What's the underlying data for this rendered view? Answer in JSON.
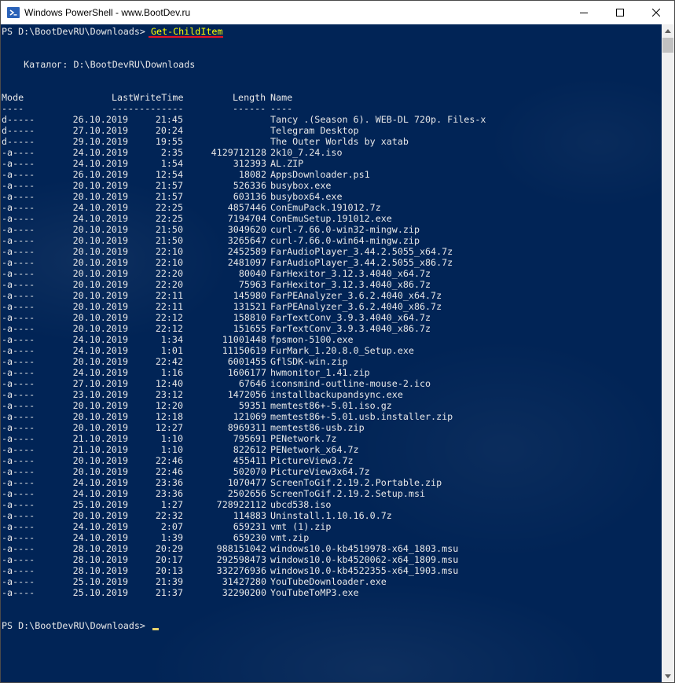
{
  "window": {
    "title": "Windows PowerShell - www.BootDev.ru",
    "controls": {
      "minimize": "minimize-icon",
      "maximize": "maximize-icon",
      "close": "close-icon"
    }
  },
  "console": {
    "prompt": "PS D:\\BootDevRU\\Downloads> ",
    "command": "Get-ChildItem",
    "directory_line": "    Каталог: D:\\BootDevRU\\Downloads",
    "headers": {
      "mode": "Mode",
      "date_time": "LastWriteTime",
      "length": "Length",
      "name": "Name"
    },
    "separators": {
      "mode": "----",
      "date_time": "-------------",
      "length": "------",
      "name": "----"
    },
    "rows": [
      {
        "mode": "d-----",
        "date": "26.10.2019",
        "time": "21:45",
        "length": "",
        "name": "Tancy .(Season 6). WEB-DL 720p. Files-x"
      },
      {
        "mode": "d-----",
        "date": "27.10.2019",
        "time": "20:24",
        "length": "",
        "name": "Telegram Desktop"
      },
      {
        "mode": "d-----",
        "date": "29.10.2019",
        "time": "19:55",
        "length": "",
        "name": "The Outer Worlds by xatab"
      },
      {
        "mode": "-a----",
        "date": "24.10.2019",
        "time": "2:35",
        "length": "4129712128",
        "name": "2k10_7.24.iso"
      },
      {
        "mode": "-a----",
        "date": "24.10.2019",
        "time": "1:54",
        "length": "312393",
        "name": "AL.ZIP"
      },
      {
        "mode": "-a----",
        "date": "26.10.2019",
        "time": "12:54",
        "length": "18082",
        "name": "AppsDownloader.ps1"
      },
      {
        "mode": "-a----",
        "date": "20.10.2019",
        "time": "21:57",
        "length": "526336",
        "name": "busybox.exe"
      },
      {
        "mode": "-a----",
        "date": "20.10.2019",
        "time": "21:57",
        "length": "603136",
        "name": "busybox64.exe"
      },
      {
        "mode": "-a----",
        "date": "24.10.2019",
        "time": "22:25",
        "length": "4857446",
        "name": "ConEmuPack.191012.7z"
      },
      {
        "mode": "-a----",
        "date": "24.10.2019",
        "time": "22:25",
        "length": "7194704",
        "name": "ConEmuSetup.191012.exe"
      },
      {
        "mode": "-a----",
        "date": "20.10.2019",
        "time": "21:50",
        "length": "3049620",
        "name": "curl-7.66.0-win32-mingw.zip"
      },
      {
        "mode": "-a----",
        "date": "20.10.2019",
        "time": "21:50",
        "length": "3265647",
        "name": "curl-7.66.0-win64-mingw.zip"
      },
      {
        "mode": "-a----",
        "date": "20.10.2019",
        "time": "22:10",
        "length": "2452589",
        "name": "FarAudioPlayer_3.44.2.5055_x64.7z"
      },
      {
        "mode": "-a----",
        "date": "20.10.2019",
        "time": "22:10",
        "length": "2481097",
        "name": "FarAudioPlayer_3.44.2.5055_x86.7z"
      },
      {
        "mode": "-a----",
        "date": "20.10.2019",
        "time": "22:20",
        "length": "80040",
        "name": "FarHexitor_3.12.3.4040_x64.7z"
      },
      {
        "mode": "-a----",
        "date": "20.10.2019",
        "time": "22:20",
        "length": "75963",
        "name": "FarHexitor_3.12.3.4040_x86.7z"
      },
      {
        "mode": "-a----",
        "date": "20.10.2019",
        "time": "22:11",
        "length": "145980",
        "name": "FarPEAnalyzer_3.6.2.4040_x64.7z"
      },
      {
        "mode": "-a----",
        "date": "20.10.2019",
        "time": "22:11",
        "length": "131521",
        "name": "FarPEAnalyzer_3.6.2.4040_x86.7z"
      },
      {
        "mode": "-a----",
        "date": "20.10.2019",
        "time": "22:12",
        "length": "158810",
        "name": "FarTextConv_3.9.3.4040_x64.7z"
      },
      {
        "mode": "-a----",
        "date": "20.10.2019",
        "time": "22:12",
        "length": "151655",
        "name": "FarTextConv_3.9.3.4040_x86.7z"
      },
      {
        "mode": "-a----",
        "date": "24.10.2019",
        "time": "1:34",
        "length": "11001448",
        "name": "fpsmon-5100.exe"
      },
      {
        "mode": "-a----",
        "date": "24.10.2019",
        "time": "1:01",
        "length": "11150619",
        "name": "FurMark_1.20.8.0_Setup.exe"
      },
      {
        "mode": "-a----",
        "date": "20.10.2019",
        "time": "22:42",
        "length": "6001455",
        "name": "GflSDK-win.zip"
      },
      {
        "mode": "-a----",
        "date": "24.10.2019",
        "time": "1:16",
        "length": "1606177",
        "name": "hwmonitor_1.41.zip"
      },
      {
        "mode": "-a----",
        "date": "27.10.2019",
        "time": "12:40",
        "length": "67646",
        "name": "iconsmind-outline-mouse-2.ico"
      },
      {
        "mode": "-a----",
        "date": "23.10.2019",
        "time": "23:12",
        "length": "1472056",
        "name": "installbackupandsync.exe"
      },
      {
        "mode": "-a----",
        "date": "20.10.2019",
        "time": "12:20",
        "length": "59351",
        "name": "memtest86+-5.01.iso.gz"
      },
      {
        "mode": "-a----",
        "date": "20.10.2019",
        "time": "12:18",
        "length": "121069",
        "name": "memtest86+-5.01.usb.installer.zip"
      },
      {
        "mode": "-a----",
        "date": "20.10.2019",
        "time": "12:27",
        "length": "8969311",
        "name": "memtest86-usb.zip"
      },
      {
        "mode": "-a----",
        "date": "21.10.2019",
        "time": "1:10",
        "length": "795691",
        "name": "PENetwork.7z"
      },
      {
        "mode": "-a----",
        "date": "21.10.2019",
        "time": "1:10",
        "length": "822612",
        "name": "PENetwork_x64.7z"
      },
      {
        "mode": "-a----",
        "date": "20.10.2019",
        "time": "22:46",
        "length": "455411",
        "name": "PictureView3.7z"
      },
      {
        "mode": "-a----",
        "date": "20.10.2019",
        "time": "22:46",
        "length": "502070",
        "name": "PictureView3x64.7z"
      },
      {
        "mode": "-a----",
        "date": "24.10.2019",
        "time": "23:36",
        "length": "1070477",
        "name": "ScreenToGif.2.19.2.Portable.zip"
      },
      {
        "mode": "-a----",
        "date": "24.10.2019",
        "time": "23:36",
        "length": "2502656",
        "name": "ScreenToGif.2.19.2.Setup.msi"
      },
      {
        "mode": "-a----",
        "date": "25.10.2019",
        "time": "1:27",
        "length": "728922112",
        "name": "ubcd538.iso"
      },
      {
        "mode": "-a----",
        "date": "20.10.2019",
        "time": "22:32",
        "length": "114883",
        "name": "Uninstall.1.10.16.0.7z"
      },
      {
        "mode": "-a----",
        "date": "24.10.2019",
        "time": "2:07",
        "length": "659231",
        "name": "vmt (1).zip"
      },
      {
        "mode": "-a----",
        "date": "24.10.2019",
        "time": "1:39",
        "length": "659230",
        "name": "vmt.zip"
      },
      {
        "mode": "-a----",
        "date": "28.10.2019",
        "time": "20:29",
        "length": "988151042",
        "name": "windows10.0-kb4519978-x64_1803.msu"
      },
      {
        "mode": "-a----",
        "date": "28.10.2019",
        "time": "20:17",
        "length": "292598473",
        "name": "windows10.0-kb4520062-x64_1809.msu"
      },
      {
        "mode": "-a----",
        "date": "28.10.2019",
        "time": "20:13",
        "length": "332276936",
        "name": "windows10.0-kb4522355-x64_1903.msu"
      },
      {
        "mode": "-a----",
        "date": "25.10.2019",
        "time": "21:39",
        "length": "31427280",
        "name": "YouTubeDownloader.exe"
      },
      {
        "mode": "-a----",
        "date": "25.10.2019",
        "time": "21:37",
        "length": "32290200",
        "name": "YouTubeToMP3.exe"
      }
    ],
    "final_prompt": "PS D:\\BootDevRU\\Downloads> "
  },
  "colors": {
    "console_bg": "#012456",
    "text": "#e8e8e8",
    "command": "#ffff00",
    "underline": "#e81123"
  }
}
